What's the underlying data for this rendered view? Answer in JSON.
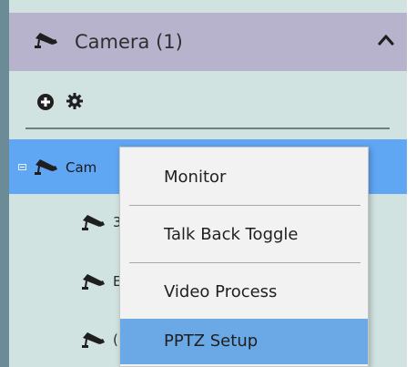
{
  "panel": {
    "title": "Camera (1)",
    "header_icon": "camera-icon",
    "collapse_icon": "chevron-up-icon"
  },
  "toolbar": {
    "add_icon": "add-circle-icon",
    "settings_icon": "gear-icon"
  },
  "tree": {
    "selected_label": "Cam",
    "selected_icon": "camera-icon",
    "children": [
      {
        "label": "3",
        "icon": "camera-icon"
      },
      {
        "label": "E",
        "icon": "camera-icon"
      },
      {
        "label": "(",
        "icon": "camera-icon"
      }
    ]
  },
  "context_menu": {
    "items": [
      {
        "label": "Monitor"
      },
      {
        "label": "Talk Back Toggle"
      },
      {
        "label": "Video Process"
      },
      {
        "label": "PPTZ Setup"
      }
    ],
    "highlighted_item": "PPTZ Setup"
  },
  "colors": {
    "header_bg": "#b7b3cc",
    "panel_bg": "#d1e3e1",
    "selection_bg": "#5fa6f3",
    "menu_highlight": "#6aa8e6"
  }
}
